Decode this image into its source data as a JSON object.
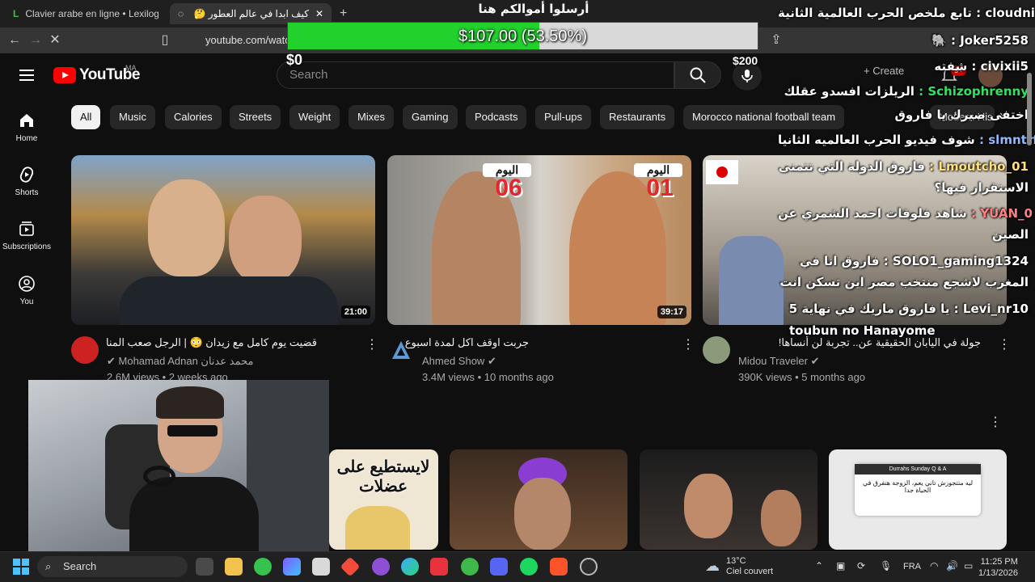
{
  "browser": {
    "tabs": [
      {
        "label": "Clavier arabe en ligne • Lexilogos"
      },
      {
        "label": "كيف ابدا في عالم العطور 🤔 !؟ - ..."
      }
    ],
    "url": "youtube.com/watch"
  },
  "donation": {
    "title": "أرسلوا أموالكم هنا",
    "amount_text": "$107.00 (53.50%)",
    "progress_percent": 53.5,
    "min": "$0",
    "max": "$200"
  },
  "youtube": {
    "wordmark": "YouTube",
    "region": "MA",
    "search_placeholder": "Search",
    "create_label": "Create",
    "notif_count": "9+",
    "sidebar": [
      {
        "label": "Home"
      },
      {
        "label": "Shorts"
      },
      {
        "label": "Subscriptions"
      },
      {
        "label": "You"
      }
    ],
    "chips": [
      "All",
      "Music",
      "Calories",
      "Streets",
      "Weight",
      "Mixes",
      "Gaming",
      "Podcasts",
      "Pull-ups",
      "Restaurants",
      "Morocco national football team",
      "Modern His"
    ],
    "videos": [
      {
        "title": "قضيت يوم كامل مع زيدان 😳 | الرجل صعب المنال !!",
        "channel": "Mohamad Adnan محمد عدنان",
        "meta": "2.6M views • 2 weeks ago",
        "duration": "21:00"
      },
      {
        "title": "جربت اوقف اكل لمدة اسبوع",
        "channel": "Ahmed Show",
        "meta": "3.4M views • 10 months ago",
        "duration": "39:17",
        "thumb_text_left": "اليوم",
        "thumb_num_left": "06",
        "thumb_text_right": "اليوم",
        "thumb_num_right": "01"
      },
      {
        "title": "جولة في اليابان الحقيقية عن.. تجربة لن أنساها!",
        "channel": "Midou Traveler",
        "meta": "390K views • 5 months ago",
        "duration": ""
      }
    ],
    "shorts": [
      {
        "overlay": "لايستطيع على عضلات"
      },
      {
        "overlay": ""
      },
      {
        "overlay": ""
      },
      {
        "overlay": "Durrahs Sunday Q & A",
        "overlay2": "ليه متتجوزش تاني يعم، الزوجة هتفرق في الحياة جدا"
      }
    ]
  },
  "chat": [
    {
      "name": "cloudnine",
      "msg": "تابع ملخص الحرب العالمية الثانية",
      "color": "white"
    },
    {
      "name": "Joker5258",
      "msg": "🐘",
      "color": "white"
    },
    {
      "name": "civixii5",
      "msg": "شفته",
      "color": "white"
    },
    {
      "name": "Schizophrenny",
      "msg": "الريلزات افسدو عقلك",
      "color": "green"
    },
    {
      "name": "",
      "msg": "اختفى صبرك يا فاروق",
      "color": "white"
    },
    {
      "name": "slmntrf",
      "msg": "شوف فيديو الحرب العالميه الثانيا",
      "color": "blue"
    },
    {
      "name": "Lmoutcho_01",
      "msg": "فاروق الدولة التي تتمنى",
      "color": "yellow"
    },
    {
      "name": "",
      "msg": "الاستقرار فيها؟",
      "color": "white"
    },
    {
      "name": "YUAN_0",
      "msg": "شاهد فلوقات احمد الشمري عن",
      "color": "red"
    },
    {
      "name": "",
      "msg": "الصين",
      "color": "white"
    },
    {
      "name": "SOLO1_gaming1324",
      "msg": "فاروق انا في",
      "color": "white"
    },
    {
      "name": "",
      "msg": "المغرب لاشجع منتخب مصر اين تسكن انت",
      "color": "white"
    },
    {
      "name": "Levi_nr10",
      "msg": "يا فاروق ماريك في نهاية 5",
      "color": "white"
    },
    {
      "name": "toubun no Hanayome",
      "msg": "",
      "color": "white"
    }
  ],
  "taskbar": {
    "search_label": "Search",
    "weather_temp": "13°C",
    "weather_desc": "Ciel couvert",
    "lang": "FRA",
    "time": "11:25 PM",
    "date": "1/13/2026"
  }
}
